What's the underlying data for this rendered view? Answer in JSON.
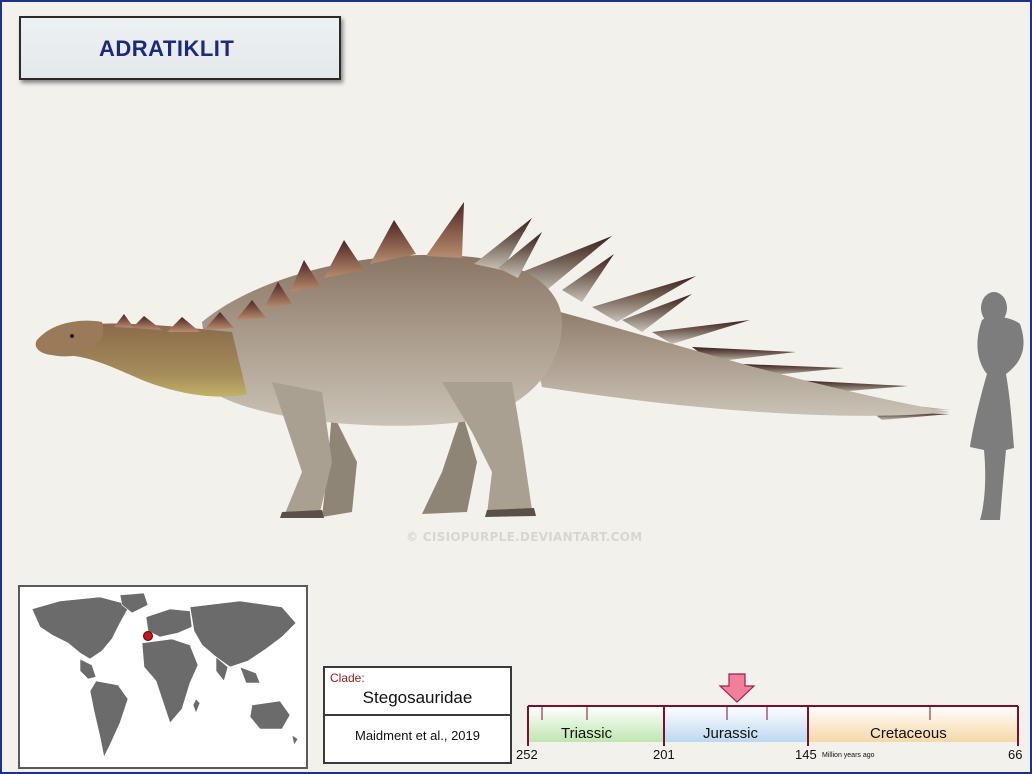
{
  "title": "ADRATIKLIT",
  "watermark": "© CISIOPURPLE.DEVIANTART.COM",
  "clade": {
    "label": "Clade:",
    "value": "Stegosauridae",
    "citation": "Maidment et al., 2019"
  },
  "timeline": {
    "periods": [
      {
        "name": "Triassic",
        "start": 252,
        "end": 201,
        "color": "#bfe6b0"
      },
      {
        "name": "Jurassic",
        "start": 201,
        "end": 145,
        "color": "#bcd8f0"
      },
      {
        "name": "Cretaceous",
        "start": 145,
        "end": 66,
        "color": "#f6d8a8"
      }
    ],
    "ticks": [
      "252",
      "201",
      "145",
      "66"
    ],
    "unit_label": "Million years ago",
    "marker_color": "#f07f99"
  },
  "colors": {
    "frame_border": "#1f2f8c",
    "title_text": "#1d2a7a",
    "timeline_line": "#7a1030",
    "map_land": "#6b6b6b",
    "location_dot": "#c2161b"
  },
  "icons": {
    "marker": "arrow-down-icon",
    "location": "location-dot-icon"
  }
}
